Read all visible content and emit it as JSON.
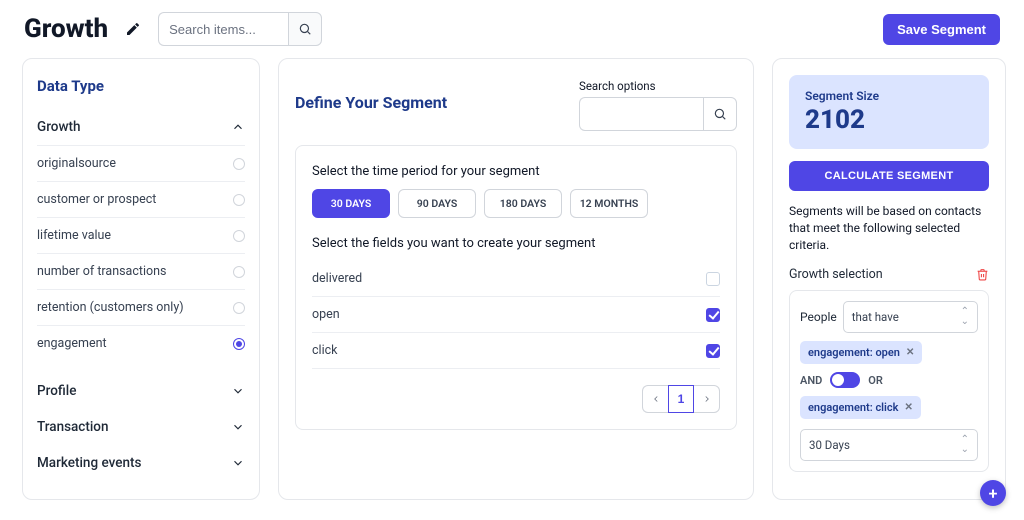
{
  "header": {
    "title": "Growth",
    "search_placeholder": "Search items...",
    "save_label": "Save Segment"
  },
  "sidebar": {
    "heading": "Data Type",
    "sections": [
      {
        "label": "Growth",
        "open": true
      },
      {
        "label": "Profile",
        "open": false
      },
      {
        "label": "Transaction",
        "open": false
      },
      {
        "label": "Marketing events",
        "open": false
      }
    ],
    "growth_items": [
      {
        "label": "originalsource",
        "selected": false
      },
      {
        "label": "customer or prospect",
        "selected": false
      },
      {
        "label": "lifetime value",
        "selected": false
      },
      {
        "label": "number of transactions",
        "selected": false
      },
      {
        "label": "retention (customers only)",
        "selected": false
      },
      {
        "label": "engagement",
        "selected": true
      }
    ]
  },
  "center": {
    "title": "Define Your Segment",
    "search_label": "Search options",
    "period_heading": "Select the time period for your segment",
    "periods": [
      "30 DAYS",
      "90 DAYS",
      "180 DAYS",
      "12 MONTHS"
    ],
    "active_period_index": 0,
    "fields_heading": "Select the fields you want to create your segment",
    "fields": [
      {
        "label": "delivered",
        "checked": false
      },
      {
        "label": "open",
        "checked": true
      },
      {
        "label": "click",
        "checked": true
      }
    ],
    "page": "1"
  },
  "right": {
    "size_label": "Segment Size",
    "size_value": "2102",
    "calc_label": "CALCULATE SEGMENT",
    "helper": "Segments will be based on contacts that meet the following selected criteria.",
    "selection_heading": "Growth selection",
    "people_label": "People",
    "people_select": "that have",
    "tags": [
      "engagement: open",
      "engagement: click"
    ],
    "logic_and": "AND",
    "logic_or": "OR",
    "range_select": "30 Days"
  }
}
